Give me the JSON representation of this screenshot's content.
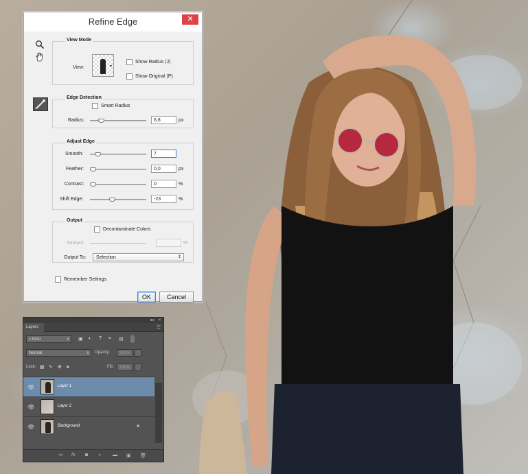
{
  "dialog": {
    "title": "Refine Edge",
    "close": "✕",
    "view_mode": {
      "heading": "View Mode",
      "view_label": "View:",
      "show_radius": "Show Radius (J)",
      "show_original": "Show Original (P)"
    },
    "edge_detection": {
      "heading": "Edge Detection",
      "smart_radius": "Smart Radius",
      "radius_label": "Radius:",
      "radius_value": "6,8",
      "radius_unit": "px",
      "radius_fraction": 0.17
    },
    "adjust_edge": {
      "heading": "Adjust Edge",
      "smooth_label": "Smooth:",
      "smooth_value": "7",
      "smooth_fraction": 0.1,
      "feather_label": "Feather:",
      "feather_value": "0,0",
      "feather_unit": "px",
      "feather_fraction": 0.0,
      "contrast_label": "Contrast:",
      "contrast_value": "0",
      "contrast_unit": "%",
      "contrast_fraction": 0.0,
      "shift_label": "Shift Edge:",
      "shift_value": "-23",
      "shift_unit": "%",
      "shift_fraction": 0.38
    },
    "output": {
      "heading": "Output",
      "decontaminate": "Decontaminate Colors",
      "amount_label": "Amount:",
      "amount_unit": "%",
      "output_to_label": "Output To:",
      "output_to_value": "Selection"
    },
    "remember": "Remember Settings",
    "ok": "OK",
    "cancel": "Cancel"
  },
  "layers_panel": {
    "tab": "Layers",
    "kind": "Kind",
    "blend_mode": "Normal",
    "opacity_label": "Opacity:",
    "opacity_value": "100%",
    "lock_label": "Lock:",
    "fill_label": "Fill:",
    "fill_value": "100%",
    "layers": [
      {
        "name": "Layer 1",
        "selected": true
      },
      {
        "name": "Layer 2",
        "selected": false
      },
      {
        "name": "Background",
        "selected": false,
        "locked": true
      }
    ]
  },
  "colors": {
    "close_button": "#e04343",
    "selected_layer": "#6d8bab",
    "panel_bg": "#535353"
  },
  "icons": [
    "zoom-icon",
    "hand-icon",
    "refine-radius-brush-icon",
    "eye-icon",
    "lock-icon",
    "link-icon",
    "fx-icon",
    "mask-icon",
    "adjustment-icon",
    "folder-icon",
    "new-layer-icon",
    "trash-icon"
  ]
}
